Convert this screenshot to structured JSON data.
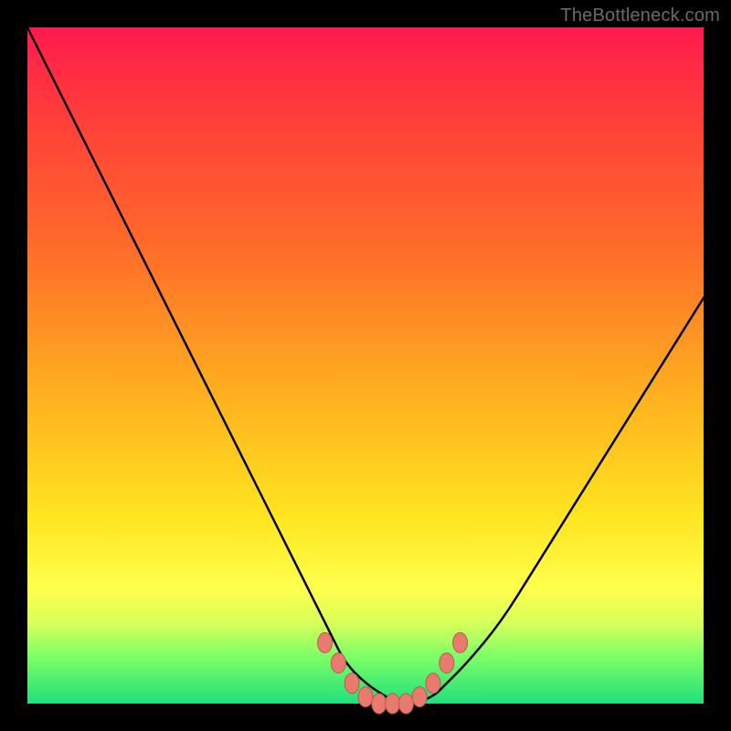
{
  "watermark": "TheBottleneck.com",
  "colors": {
    "frame": "#000000",
    "curve": "#000000",
    "marker_fill": "#e97a6e",
    "marker_stroke": "#b85a4e"
  },
  "chart_data": {
    "type": "line",
    "title": "",
    "xlabel": "",
    "ylabel": "",
    "xlim": [
      0,
      100
    ],
    "ylim": [
      0,
      100
    ],
    "x": [
      0,
      5,
      10,
      15,
      20,
      25,
      30,
      35,
      40,
      45,
      47,
      50,
      53,
      55,
      57,
      60,
      62,
      65,
      70,
      75,
      80,
      85,
      90,
      95,
      100
    ],
    "values": [
      100,
      90,
      80,
      70,
      60,
      50,
      40,
      30,
      20,
      10,
      6,
      3,
      1,
      0,
      0,
      1,
      3,
      6,
      12,
      20,
      28,
      36,
      44,
      52,
      60
    ],
    "markers": {
      "x": [
        44,
        46,
        48,
        50,
        52,
        54,
        56,
        58,
        60,
        62,
        64
      ],
      "values": [
        9,
        6,
        3,
        1,
        0,
        0,
        0,
        1,
        3,
        6,
        9
      ]
    }
  }
}
